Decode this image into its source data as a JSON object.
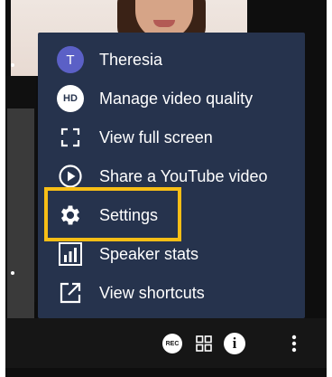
{
  "participant": {
    "name": "Theresia",
    "initial": "T"
  },
  "menu": {
    "items": [
      {
        "icon": "avatar",
        "label": "Theresia"
      },
      {
        "icon": "hd-icon",
        "badge": "HD",
        "label": "Manage video quality"
      },
      {
        "icon": "fullscreen-icon",
        "label": "View full screen"
      },
      {
        "icon": "play-circle-icon",
        "label": "Share a YouTube video"
      },
      {
        "icon": "gear-icon",
        "label": "Settings"
      },
      {
        "icon": "bar-chart-icon",
        "label": "Speaker stats"
      },
      {
        "icon": "external-link-icon",
        "label": "View shortcuts"
      }
    ],
    "highlighted_item": "Settings"
  },
  "toolbar": {
    "rec_label": "REC",
    "info_label": "i"
  },
  "colors": {
    "menu_bg": "#26334d",
    "highlight": "#f7be16",
    "avatar": "#5b60c6",
    "background": "#0e0e0e"
  }
}
